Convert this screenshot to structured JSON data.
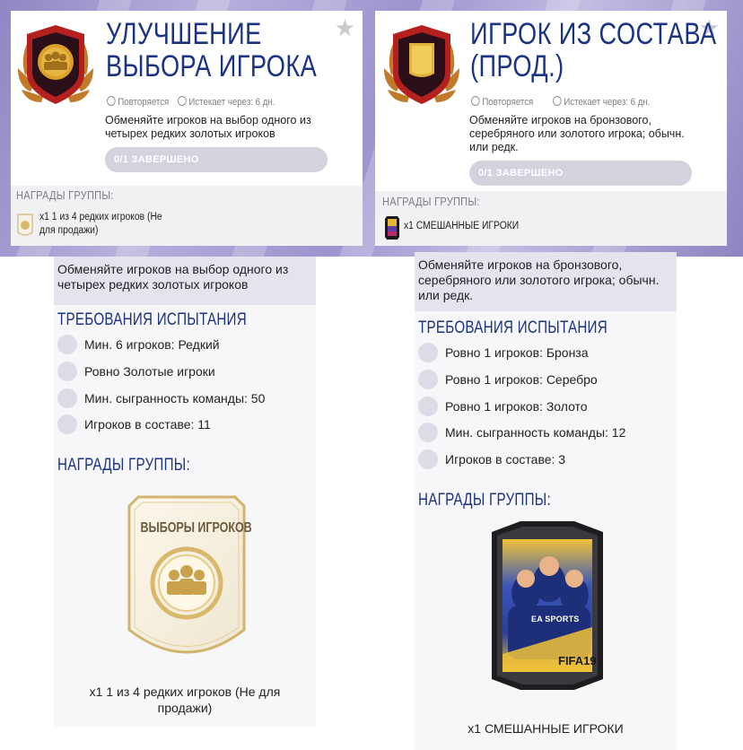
{
  "cards": [
    {
      "title_line1": "УЛУЧШЕНИЕ",
      "title_line2": "ВЫБОРА ИГРОКА",
      "repeat_label": "Повторяется",
      "expires_label": "Истекает через: 6 дн.",
      "description": "Обменяйте игроков на выбор одного из четырех редких золотых игроков",
      "progress": "0/1 ЗАВЕРШЕНО",
      "group_rewards_title": "НАГРАДЫ ГРУППЫ:",
      "reward_text": "x1 1 из 4 редких игроков (Не для продажи)"
    },
    {
      "title_line1": "ИГРОК ИЗ СОСТАВА",
      "title_line2": "(ПРОД.)",
      "repeat_label": "Повторяется",
      "expires_label": "Истекает через: 6 дн.",
      "description": "Обменяйте игроков на бронзового, серебряного или золотого игрока; обычн. или редк.",
      "progress": "0/1 ЗАВЕРШЕНО",
      "group_rewards_title": "НАГРАДЫ ГРУППЫ:",
      "reward_text": "x1 СМЕШАННЫЕ ИГРОКИ"
    }
  ],
  "panels": [
    {
      "description": "Обменяйте игроков на выбор одного из четырех редких золотых игроков",
      "requirements_title": "ТРЕБОВАНИЯ ИСПЫТАНИЯ",
      "requirements": [
        "Мин. 6 игроков: Редкий",
        "Ровно Золотые игроки",
        "Мин. сыгранность команды: 50",
        "Игроков в составе: 11"
      ],
      "rewards_title": "НАГРАДЫ ГРУППЫ:",
      "reward_card_title": "ВЫБОРЫ ИГРОКОВ",
      "reward_caption": "x1 1 из 4 редких игроков (Не для продажи)"
    },
    {
      "description": "Обменяйте игроков на бронзового, серебряного или золотого игрока; обычн. или редк.",
      "requirements_title": "ТРЕБОВАНИЯ ИСПЫТАНИЯ",
      "requirements": [
        "Ровно 1 игроков: Бронза",
        "Ровно 1 игроков: Серебро",
        "Ровно 1 игроков: Золото",
        "Мин. сыгранность команды: 12",
        "Игроков в составе: 3"
      ],
      "rewards_title": "НАГРАДЫ ГРУППЫ:",
      "pack_brand": "FIFA19",
      "pack_sponsor": "EA SPORTS",
      "reward_caption": "x1 СМЕШАННЫЕ ИГРОКИ"
    }
  ],
  "colors": {
    "title_blue": "#1b3383",
    "progress_bg": "#d3d2dd",
    "badge_red": "#b3201d",
    "badge_gold": "#d9a02a"
  },
  "icons": [
    "star-icon",
    "repeat-icon",
    "timer-icon",
    "players-badge-icon",
    "gold-card-badge-icon",
    "mixed-pack-icon"
  ]
}
